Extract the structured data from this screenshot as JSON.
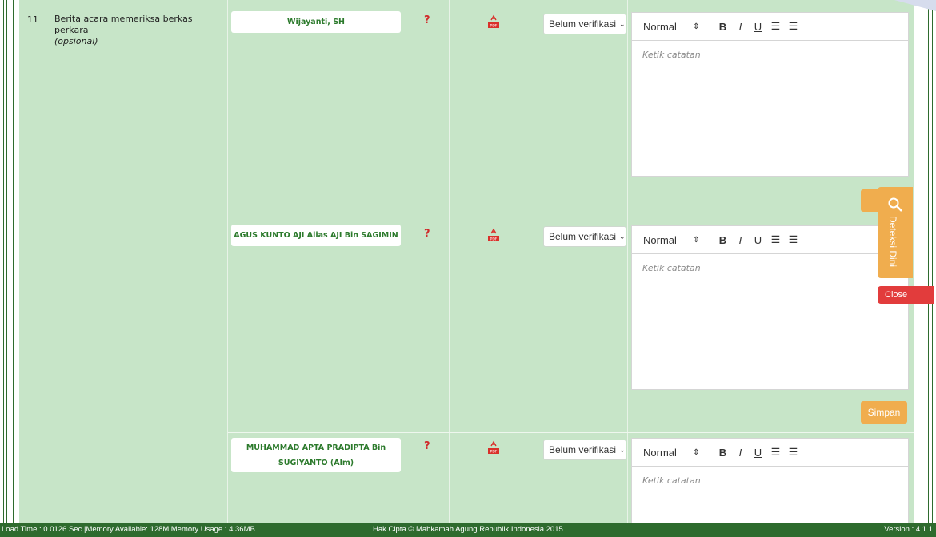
{
  "row": {
    "number": "11",
    "title": "Berita acara memeriksa berkas perkara",
    "subtitle": "(opsional)"
  },
  "entries": [
    {
      "name": "Wijayanti, SH",
      "status_mark": "?",
      "pdf_icon": "pdf-icon",
      "verification": "Belum verifikasi",
      "editor": {
        "format": "Normal",
        "bold": "B",
        "italic": "I",
        "underline": "U",
        "placeholder": "Ketik catatan"
      },
      "save_label": "Si"
    },
    {
      "name": "AGUS KUNTO AJI Alias AJI Bin SAGIMIN",
      "status_mark": "?",
      "pdf_icon": "pdf-icon",
      "verification": "Belum verifikasi",
      "editor": {
        "format": "Normal",
        "bold": "B",
        "italic": "I",
        "underline": "U",
        "placeholder": "Ketik catatan"
      },
      "save_label": "Simpan"
    },
    {
      "name": "MUHAMMAD APTA PRADIPTA Bin SUGIYANTO (Alm)",
      "status_mark": "?",
      "pdf_icon": "pdf-icon",
      "verification": "Belum verifikasi",
      "editor": {
        "format": "Normal",
        "bold": "B",
        "italic": "I",
        "underline": "U",
        "placeholder": "Ketik catatan"
      }
    }
  ],
  "widget": {
    "label": "Deteksi Dini",
    "close_label": "Close"
  },
  "footer": {
    "load_info": "Load Time : 0.0126 Sec.|Memory Available: 128M|Memory Usage : 4.36MB",
    "copyright": "Hak Cipta © Mahkamah Agung Republik Indonesia 2015",
    "version": "Version : 4.1.1"
  },
  "colors": {
    "row_bg": "#c7e5c8",
    "name_text": "#2c7a2c",
    "save_button": "#f0ad4e",
    "close_button": "#e23c3c",
    "footer_bg": "#2e6b2e"
  }
}
